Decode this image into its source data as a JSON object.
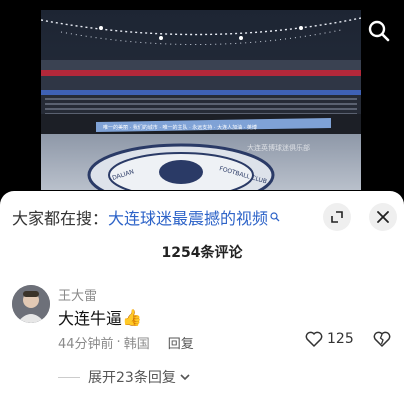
{
  "video": {
    "banner_text": "唯一的美丽 · 我们的城市 · 唯一的主队 · 永远支持 · 大连人加油 · 英博",
    "watermark": "大连英博球迷俱乐部",
    "logo_text_left": "DALIAN",
    "logo_text_right": "FOOTBALL CLUB"
  },
  "search": {
    "prefix": "大家都在搜：",
    "term": "大连球迷最震撼的视频",
    "icon": "search-icon"
  },
  "header": {
    "comment_count": "1254条评论",
    "expand_icon": "expand-icon",
    "close_icon": "close-icon"
  },
  "comment": {
    "user": "王大雷",
    "text": "大连牛逼",
    "emoji": "👍",
    "time": "44分钟前",
    "separator": "·",
    "location": "韩国",
    "reply_label": "回复",
    "likes": "125",
    "like_icon": "heart-icon",
    "dislike_icon": "broken-heart-icon"
  },
  "replies": {
    "expand_label": "展开23条回复"
  },
  "colors": {
    "search_term": "#2d63c8",
    "sheet_bg": "#ffffff",
    "muted": "#8a8a8a"
  }
}
